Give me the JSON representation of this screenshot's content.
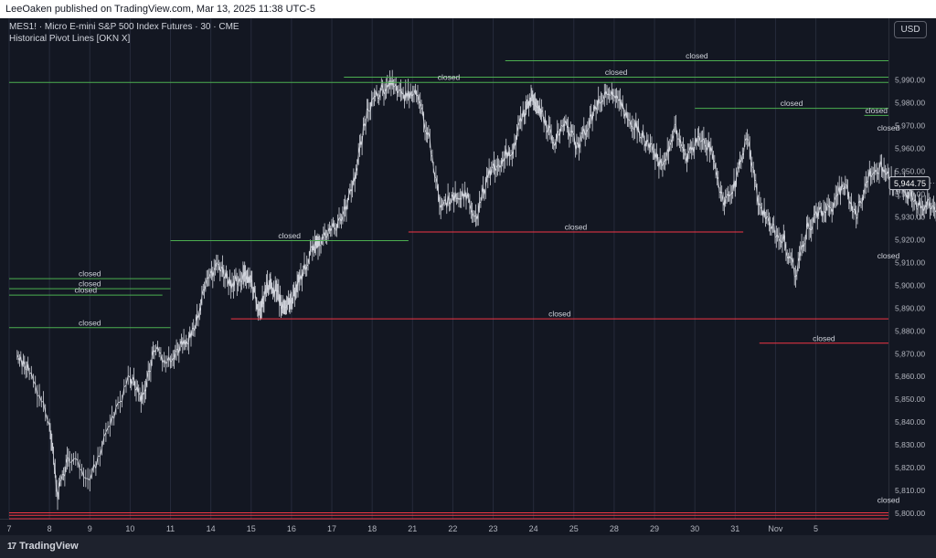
{
  "topbar": {
    "text": "LeeOaken published on TradingView.com, Mar 13, 2025 11:38 UTC-5"
  },
  "legend": {
    "line1": "MES1! · Micro E-mini S&P 500 Index Futures · 30 · CME",
    "line2": "Historical Pivot Lines [OKN X]"
  },
  "currency_button": "USD",
  "footer": {
    "brand": "TradingView",
    "logo_glyph": "17"
  },
  "colors": {
    "background": "#131722",
    "price": "#d1d4dc",
    "resistance": "#4caf50",
    "support": "#f23645"
  },
  "chart_data": {
    "type": "line",
    "title": "MES1! · Micro E-mini S&P 500 Index Futures · 30 · CME",
    "ylim": [
      5795,
      6000
    ],
    "y_ticks": [
      5800,
      5810,
      5820,
      5830,
      5840,
      5850,
      5860,
      5870,
      5880,
      5890,
      5900,
      5910,
      5920,
      5930,
      5940,
      5950,
      5960,
      5970,
      5980,
      5990
    ],
    "x_ticks": [
      "7",
      "8",
      "9",
      "10",
      "11",
      "14",
      "15",
      "16",
      "17",
      "18",
      "21",
      "22",
      "23",
      "24",
      "25",
      "28",
      "29",
      "30",
      "31",
      "Nov",
      "5"
    ],
    "last_price": "5,944.75",
    "series": [
      {
        "values": [
          [
            0.2,
            5870
          ],
          [
            0.5,
            5862
          ],
          [
            1.0,
            5840
          ],
          [
            1.2,
            5808
          ],
          [
            1.5,
            5825
          ],
          [
            2.0,
            5815
          ],
          [
            2.5,
            5840
          ],
          [
            3.0,
            5860
          ],
          [
            3.3,
            5850
          ],
          [
            3.6,
            5872
          ],
          [
            4.0,
            5865
          ],
          [
            4.3,
            5875
          ],
          [
            4.6,
            5880
          ],
          [
            4.9,
            5904
          ],
          [
            5.2,
            5908
          ],
          [
            5.5,
            5900
          ],
          [
            5.8,
            5905
          ],
          [
            6.0,
            5902
          ],
          [
            6.2,
            5888
          ],
          [
            6.4,
            5900
          ],
          [
            6.6,
            5898
          ],
          [
            6.8,
            5890
          ],
          [
            7.0,
            5894
          ],
          [
            7.2,
            5902
          ],
          [
            7.5,
            5915
          ],
          [
            7.7,
            5918
          ],
          [
            8.0,
            5925
          ],
          [
            8.3,
            5930
          ],
          [
            8.6,
            5950
          ],
          [
            8.9,
            5978
          ],
          [
            9.2,
            5985
          ],
          [
            9.5,
            5988
          ],
          [
            9.8,
            5983
          ],
          [
            10.1,
            5985
          ],
          [
            10.4,
            5965
          ],
          [
            10.7,
            5935
          ],
          [
            11.0,
            5938
          ],
          [
            11.3,
            5940
          ],
          [
            11.6,
            5930
          ],
          [
            11.9,
            5950
          ],
          [
            12.2,
            5955
          ],
          [
            12.5,
            5960
          ],
          [
            12.8,
            5978
          ],
          [
            13.0,
            5983
          ],
          [
            13.2,
            5975
          ],
          [
            13.5,
            5963
          ],
          [
            13.8,
            5970
          ],
          [
            14.1,
            5960
          ],
          [
            14.4,
            5972
          ],
          [
            14.7,
            5983
          ],
          [
            15.0,
            5985
          ],
          [
            15.3,
            5975
          ],
          [
            15.6,
            5968
          ],
          [
            15.9,
            5960
          ],
          [
            16.2,
            5952
          ],
          [
            16.5,
            5970
          ],
          [
            16.8,
            5955
          ],
          [
            17.1,
            5965
          ],
          [
            17.4,
            5960
          ],
          [
            17.7,
            5935
          ],
          [
            18.0,
            5945
          ],
          [
            18.3,
            5965
          ],
          [
            18.6,
            5935
          ],
          [
            18.9,
            5925
          ],
          [
            19.2,
            5920
          ],
          [
            19.5,
            5905
          ],
          [
            19.8,
            5925
          ],
          [
            20.1,
            5932
          ],
          [
            20.4,
            5935
          ],
          [
            20.7,
            5945
          ],
          [
            21.0,
            5930
          ],
          [
            21.3,
            5948
          ],
          [
            21.6,
            5952
          ],
          [
            21.9,
            5945
          ],
          [
            22.2,
            5942
          ],
          [
            22.5,
            5936
          ],
          [
            22.8,
            5935
          ],
          [
            23.1,
            5930
          ],
          [
            23.4,
            5940
          ],
          [
            23.7,
            5945
          ],
          [
            24.0,
            5958
          ],
          [
            24.3,
            5955
          ],
          [
            24.6,
            5950
          ],
          [
            24.9,
            5935
          ],
          [
            25.2,
            5950
          ],
          [
            25.5,
            5928
          ],
          [
            25.8,
            5908
          ],
          [
            26.0,
            5900
          ],
          [
            26.2,
            5893
          ],
          [
            26.4,
            5884
          ],
          [
            26.6,
            5878
          ],
          [
            26.8,
            5850
          ],
          [
            27.0,
            5830
          ],
          [
            27.3,
            5822
          ],
          [
            27.6,
            5815
          ],
          [
            27.9,
            5825
          ],
          [
            28.2,
            5835
          ],
          [
            28.5,
            5860
          ],
          [
            28.8,
            5835
          ],
          [
            29.1,
            5840
          ],
          [
            29.4,
            5850
          ],
          [
            29.7,
            5845
          ],
          [
            30.0,
            5830
          ],
          [
            30.3,
            5818
          ],
          [
            30.6,
            5808
          ],
          [
            30.9,
            5815
          ],
          [
            31.2,
            5820
          ],
          [
            31.5,
            5825
          ],
          [
            31.8,
            5835
          ],
          [
            32.0,
            5862
          ],
          [
            32.3,
            5880
          ],
          [
            32.6,
            5893
          ],
          [
            32.9,
            5908
          ],
          [
            33.2,
            5925
          ],
          [
            33.4,
            5944.75
          ]
        ]
      }
    ],
    "pivot_lines": [
      {
        "type": "high",
        "label": "closed",
        "start": 12.3,
        "end": 33.5,
        "price": 5998.5
      },
      {
        "type": "high",
        "label": "closed",
        "start": 8.3,
        "end": 33.5,
        "price": 5991.3
      },
      {
        "type": "high",
        "label": "closed",
        "start": 0.0,
        "end": 33.5,
        "price": 5989.0
      },
      {
        "type": "high",
        "label": "closed",
        "start": 17.0,
        "end": 33.5,
        "price": 5977.6
      },
      {
        "type": "high",
        "label": "closed",
        "start": 21.2,
        "end": 33.5,
        "price": 5974.5
      },
      {
        "type": "high",
        "label": "closed",
        "start": 24.7,
        "end": 33.5,
        "price": 5966.8
      },
      {
        "type": "high",
        "label": "closed",
        "start": 4.0,
        "end": 9.9,
        "price": 5919.6
      },
      {
        "type": "high",
        "label": "closed",
        "start": 0.0,
        "end": 4.0,
        "price": 5902.9
      },
      {
        "type": "high",
        "label": "closed",
        "start": 0.0,
        "end": 4.0,
        "price": 5898.5
      },
      {
        "type": "high",
        "label": "closed",
        "start": 0.0,
        "end": 3.8,
        "price": 5895.7
      },
      {
        "type": "high",
        "label": "closed",
        "start": 0.0,
        "end": 4.0,
        "price": 5881.4
      },
      {
        "type": "low",
        "label": "closed",
        "start": 9.9,
        "end": 18.2,
        "price": 5923.4
      },
      {
        "type": "low",
        "label": "closed",
        "start": 24.0,
        "end": 25.9,
        "price": 5910.8
      },
      {
        "type": "low",
        "label": "closed",
        "start": 5.5,
        "end": 26.5,
        "price": 5885.3
      },
      {
        "type": "low",
        "label": "closed",
        "start": 18.6,
        "end": 26.9,
        "price": 5874.6
      },
      {
        "type": "low",
        "label": "closed",
        "start": 27.3,
        "end": 33.5,
        "price": 5803.6
      },
      {
        "type": "low",
        "label": "closed",
        "start": 0.0,
        "end": 33.5,
        "price": 5800.2
      },
      {
        "type": "low",
        "label": "closed",
        "start": 0.0,
        "end": 33.5,
        "price": 5799.1
      },
      {
        "type": "low",
        "label": "closed",
        "start": 30.0,
        "end": 33.5,
        "price": 5798.5
      },
      {
        "type": "low",
        "label": "closed",
        "start": 0.0,
        "end": 33.5,
        "price": 5797.6
      }
    ]
  }
}
